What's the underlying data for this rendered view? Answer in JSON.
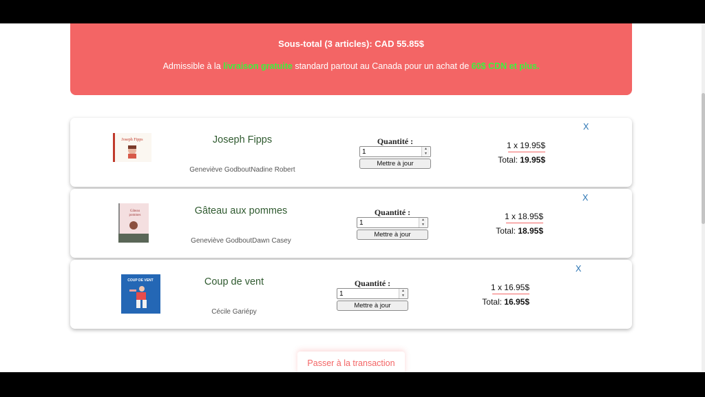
{
  "summary": {
    "subtotal": "Sous-total (3 articles): CAD 55.85$",
    "note_prefix": "Admissible à la ",
    "note_highlight1": "livraison gratuite",
    "note_middle": " standard partout au Canada pour un achat de ",
    "note_highlight2": "60$ CDN et plus.",
    "accent_color": "#f36565",
    "highlight_color": "#3df23d"
  },
  "common": {
    "quantity_label": "Quantité :",
    "update_label": "Mettre à jour",
    "remove_label": "X"
  },
  "items": [
    {
      "title": "Joseph Fipps",
      "authors": "Geneviève GodboutNadine Robert",
      "quantity": "1",
      "unit_price": "1 x 19.95$",
      "total_label": "Total: ",
      "total_value": "19.95$",
      "cover_icon": "book-cover-joseph-fipps"
    },
    {
      "title": "Gâteau aux pommes",
      "authors": "Geneviève GodboutDawn Casey",
      "quantity": "1",
      "unit_price": "1 x 18.95$",
      "total_label": "Total: ",
      "total_value": "18.95$",
      "cover_icon": "book-cover-gateau-aux-pommes"
    },
    {
      "title": "Coup de vent",
      "authors": "Cécile Gariépy",
      "quantity": "1",
      "unit_price": "1 x 16.95$",
      "total_label": "Total: ",
      "total_value": "16.95$",
      "cover_icon": "book-cover-coup-de-vent"
    }
  ],
  "checkout": {
    "label": "Passer à la transaction"
  }
}
